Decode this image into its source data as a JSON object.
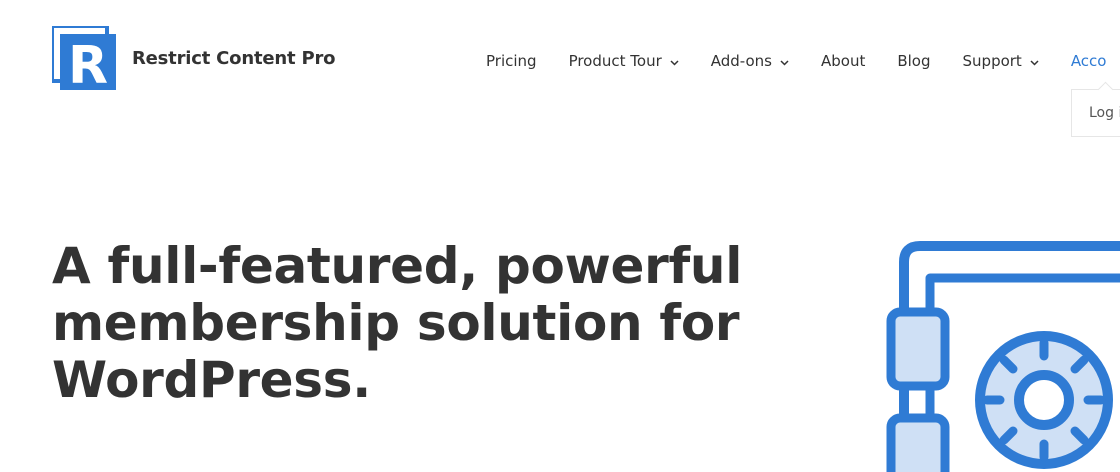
{
  "brand": {
    "name": "Restrict Content Pro",
    "logo_letter": "R",
    "logo_icon": "rcp-logo-icon",
    "accent_color": "#2f7bd4"
  },
  "nav": {
    "items": [
      {
        "label": "Pricing",
        "has_dropdown": false
      },
      {
        "label": "Product Tour",
        "has_dropdown": true
      },
      {
        "label": "Add-ons",
        "has_dropdown": true
      },
      {
        "label": "About",
        "has_dropdown": false
      },
      {
        "label": "Blog",
        "has_dropdown": false
      },
      {
        "label": "Support",
        "has_dropdown": true
      },
      {
        "label": "Acco",
        "has_dropdown": false,
        "active": true
      }
    ],
    "dropdown_icon": "chevron-down-icon"
  },
  "account_dropdown": {
    "items": [
      {
        "label": "Log i"
      }
    ]
  },
  "hero": {
    "headline_lines": [
      "A full-featured, powerful",
      "membership solution for",
      "WordPress."
    ],
    "illustration": "vault-safe-icon",
    "illustration_fill": "#cfe0f5"
  }
}
